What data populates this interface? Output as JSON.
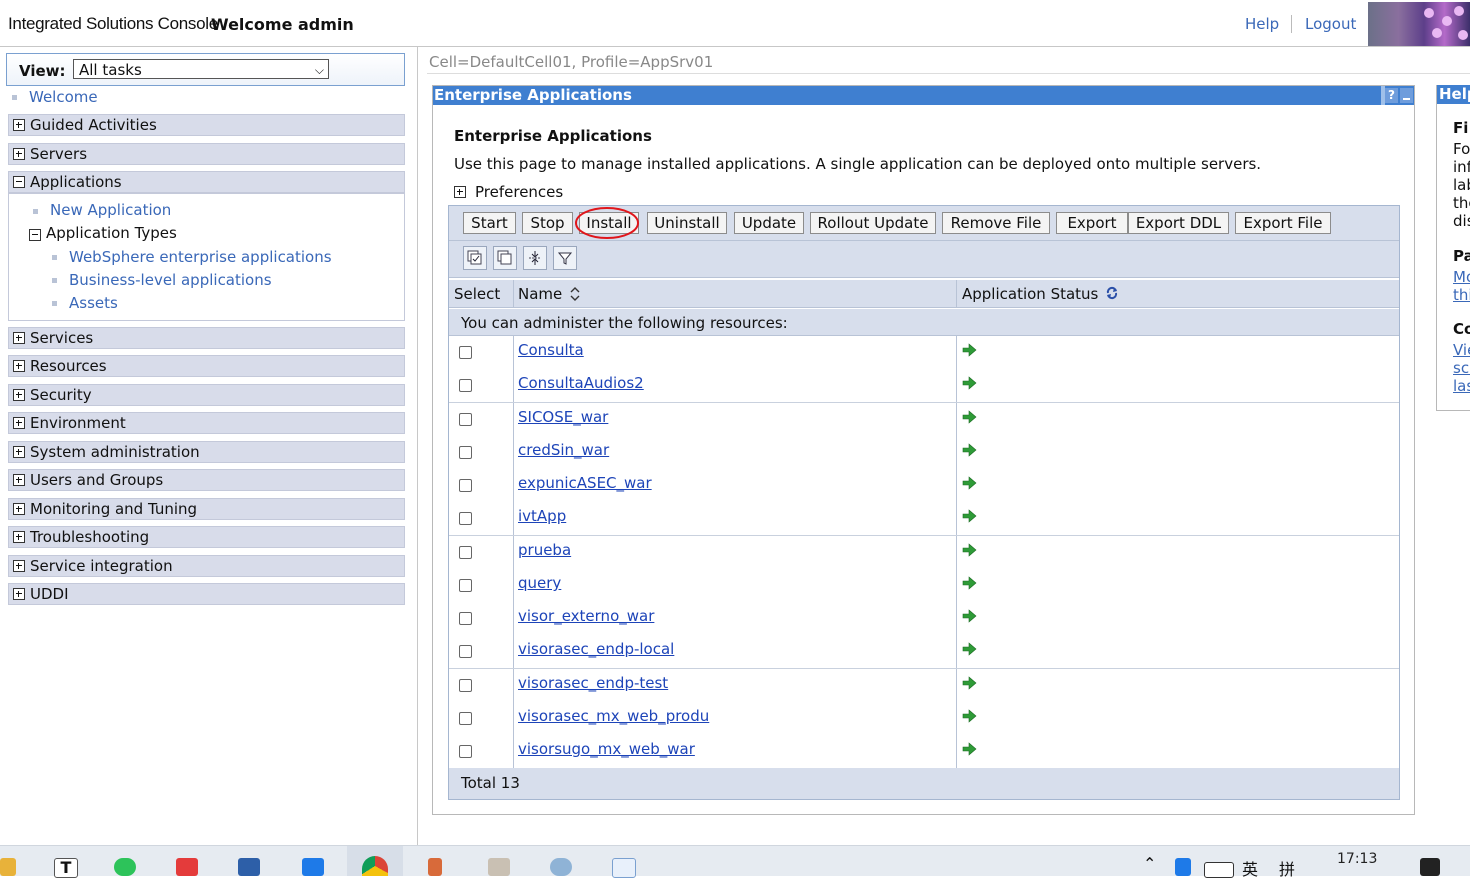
{
  "header": {
    "brand": "Integrated Solutions Console",
    "welcome": "Welcome admin",
    "help": "Help",
    "logout": "Logout"
  },
  "nav": {
    "view_label": "View:",
    "view_value": "All tasks",
    "welcome": "Welcome",
    "categories": [
      "Guided Activities",
      "Servers",
      "Applications",
      "Services",
      "Resources",
      "Security",
      "Environment",
      "System administration",
      "Users and Groups",
      "Monitoring and Tuning",
      "Troubleshooting",
      "Service integration",
      "UDDI"
    ],
    "apps": {
      "new_application": "New Application",
      "application_types": "Application Types",
      "types": [
        "WebSphere enterprise applications",
        "Business-level applications",
        "Assets"
      ]
    }
  },
  "main": {
    "cell_profile": "Cell=DefaultCell01, Profile=AppSrv01",
    "portlet_title": "Enterprise Applications",
    "help_btn": "?",
    "heading": "Enterprise Applications",
    "description": "Use this page to manage installed applications. A single application can be deployed onto multiple servers.",
    "preferences": "Preferences",
    "buttons": [
      "Start",
      "Stop",
      "Install",
      "Uninstall",
      "Update",
      "Rollout Update",
      "Remove File",
      "Export",
      "Export DDL",
      "Export File"
    ],
    "columns": {
      "select": "Select",
      "name": "Name",
      "status": "Application Status"
    },
    "admin_text": "You can administer the following resources:",
    "applications": [
      "Consulta",
      "ConsultaAudios2",
      "SICOSE_war",
      "credSin_war",
      "expunicASEC_war",
      "ivtApp",
      "prueba",
      "query",
      "visor_externo_war",
      "visorasec_endp-local",
      "visorasec_endp-test",
      "visorasec_mx_web_produ",
      "visorsugo_mx_web_war"
    ],
    "total": "Total 13"
  },
  "help_panel": {
    "title": "Help",
    "snippets": [
      "Fi",
      "Fo",
      "inf",
      "lab",
      "the",
      "dis",
      "Pa",
      "Mo",
      "thi",
      "Co",
      "Vie",
      "scr",
      "las"
    ]
  },
  "taskbar": {
    "clock": "17:13",
    "ime_1": "英",
    "ime_2": "拼"
  },
  "colors": {
    "title_bar": "#3f7fd0",
    "nav_category": "#d8dcea",
    "table_header": "#d7deec",
    "link": "#1d44b8",
    "status_green": "#2e9b37",
    "annotation_red": "#e0161b"
  }
}
